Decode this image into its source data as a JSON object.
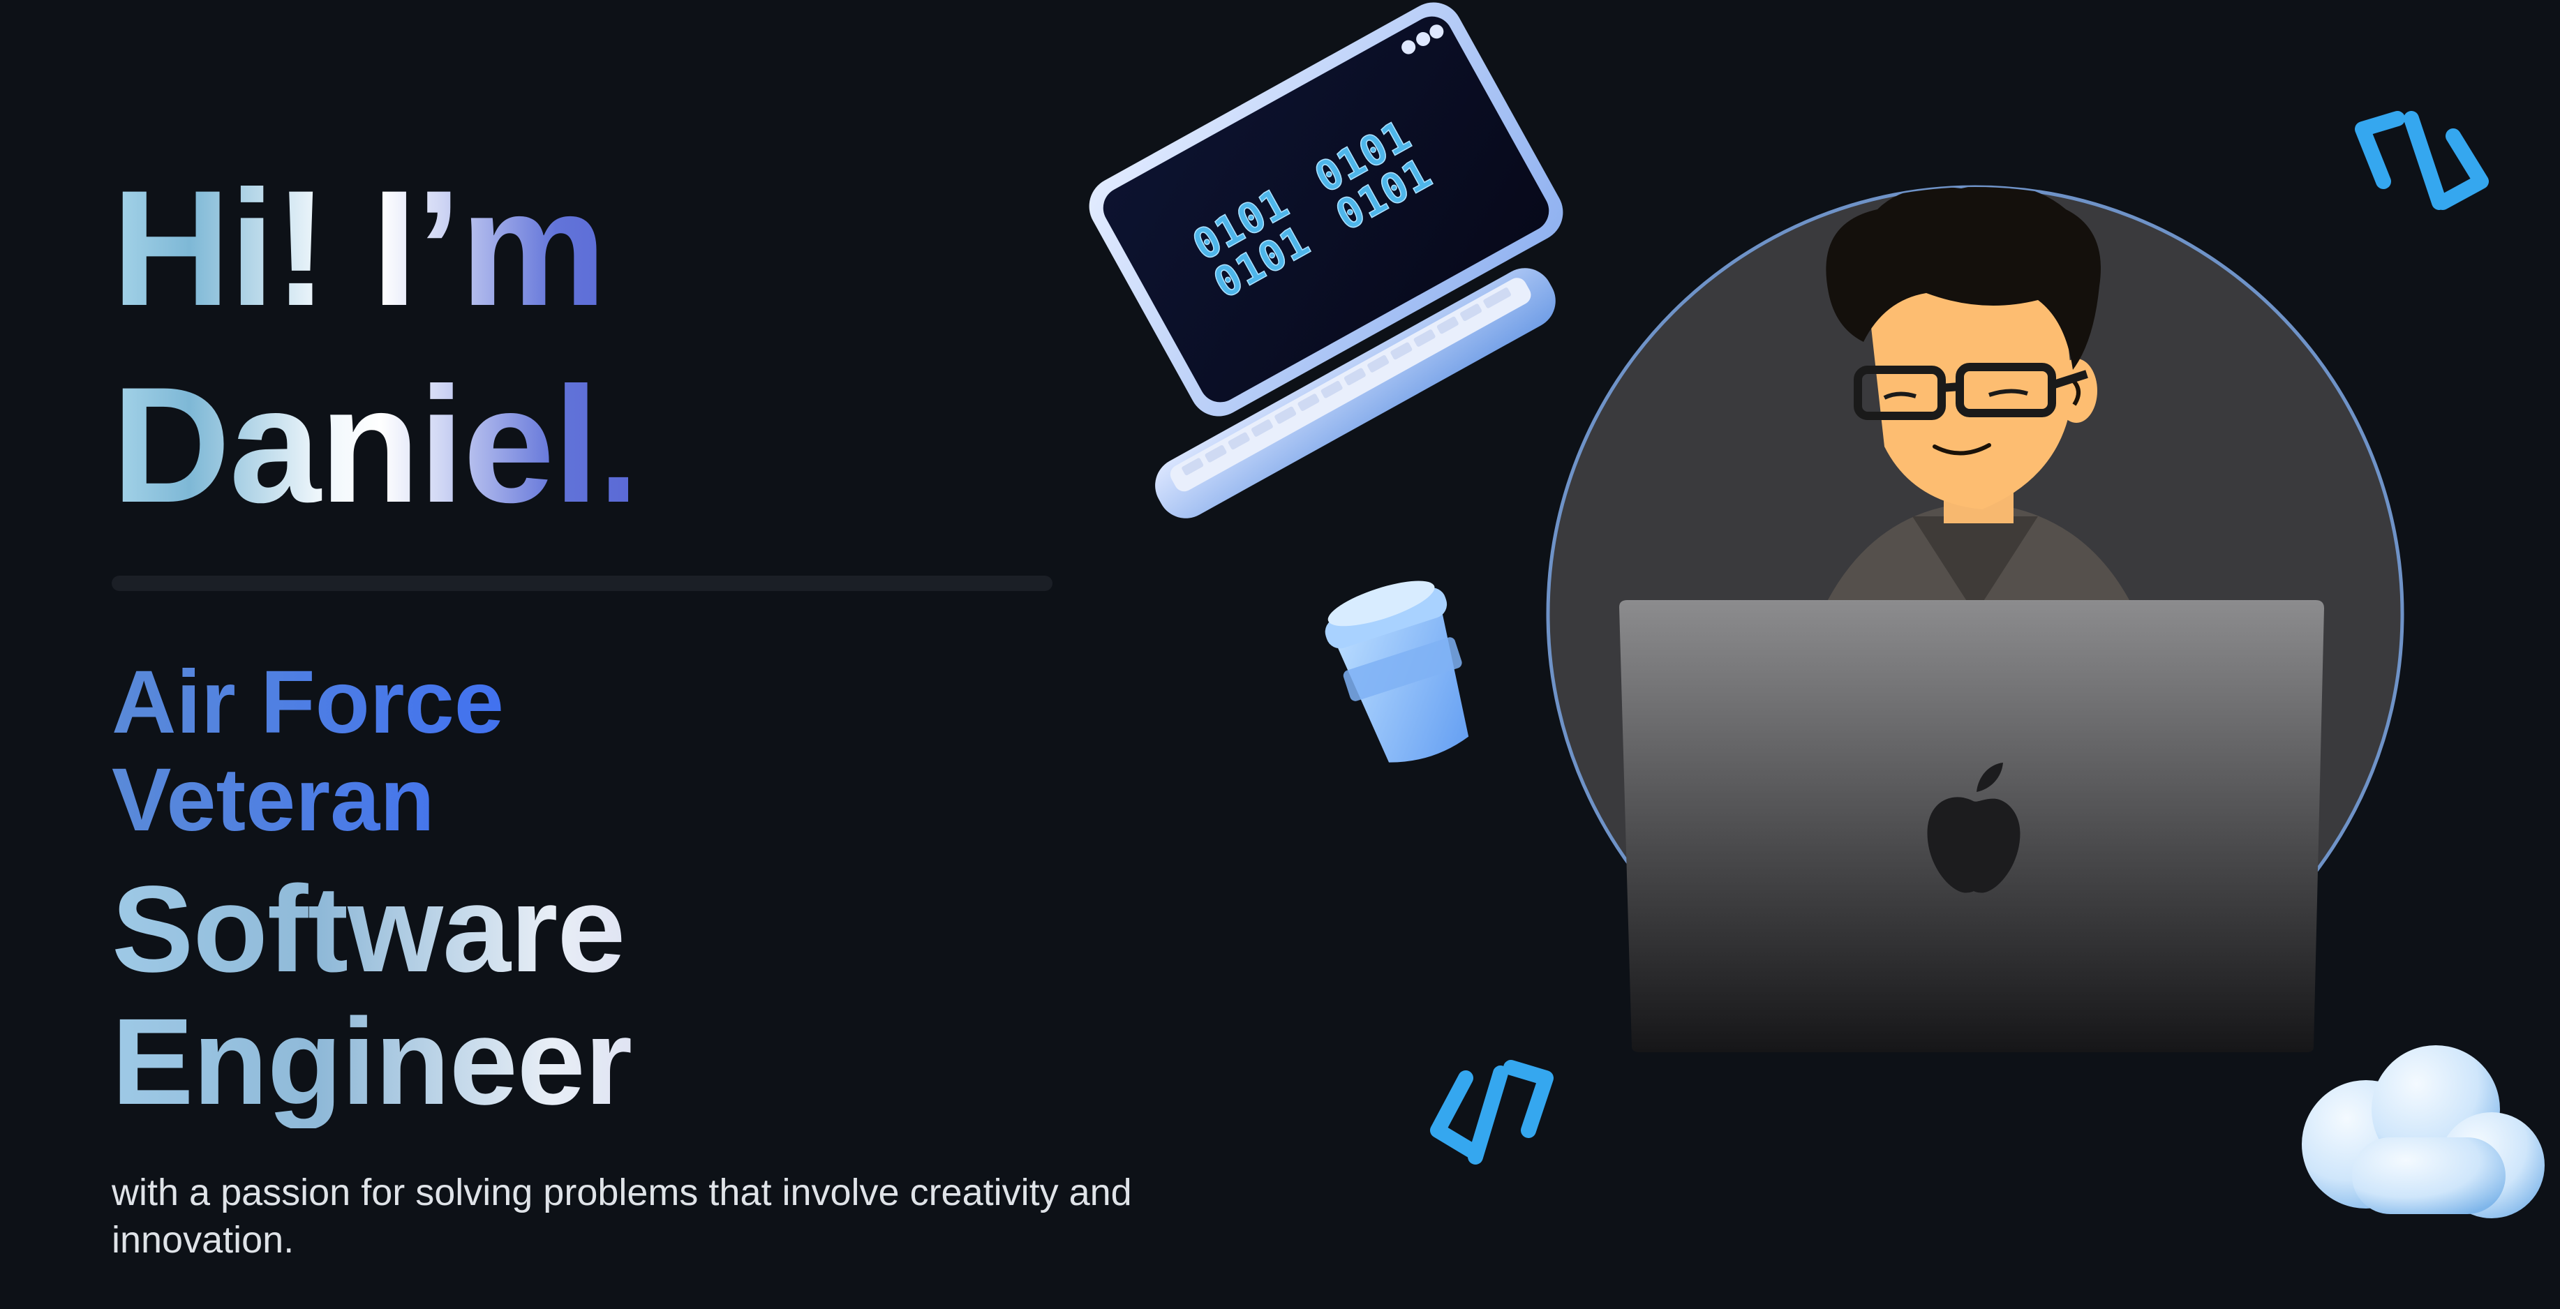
{
  "hero": {
    "greeting_line1": "Hi! I’m",
    "greeting_line2": "Daniel.",
    "subtitle": "Air Force Veteran",
    "role": "Software Engineer",
    "tagline": "with a passion for solving problems that involve creativity and innovation."
  },
  "illustration": {
    "laptop_screen_text": [
      "0101",
      "0101",
      "0101",
      "0101"
    ],
    "icons": [
      "floating-laptop-icon",
      "coffee-cup-icon",
      "code-brackets-icon",
      "cloud-icon",
      "apple-logo-icon"
    ]
  },
  "colors": {
    "background": "#0d1117",
    "accent_blue": "#3f6ff2",
    "icon_blue": "#35a7ef",
    "avatar_circle": "#3a3a3d"
  }
}
